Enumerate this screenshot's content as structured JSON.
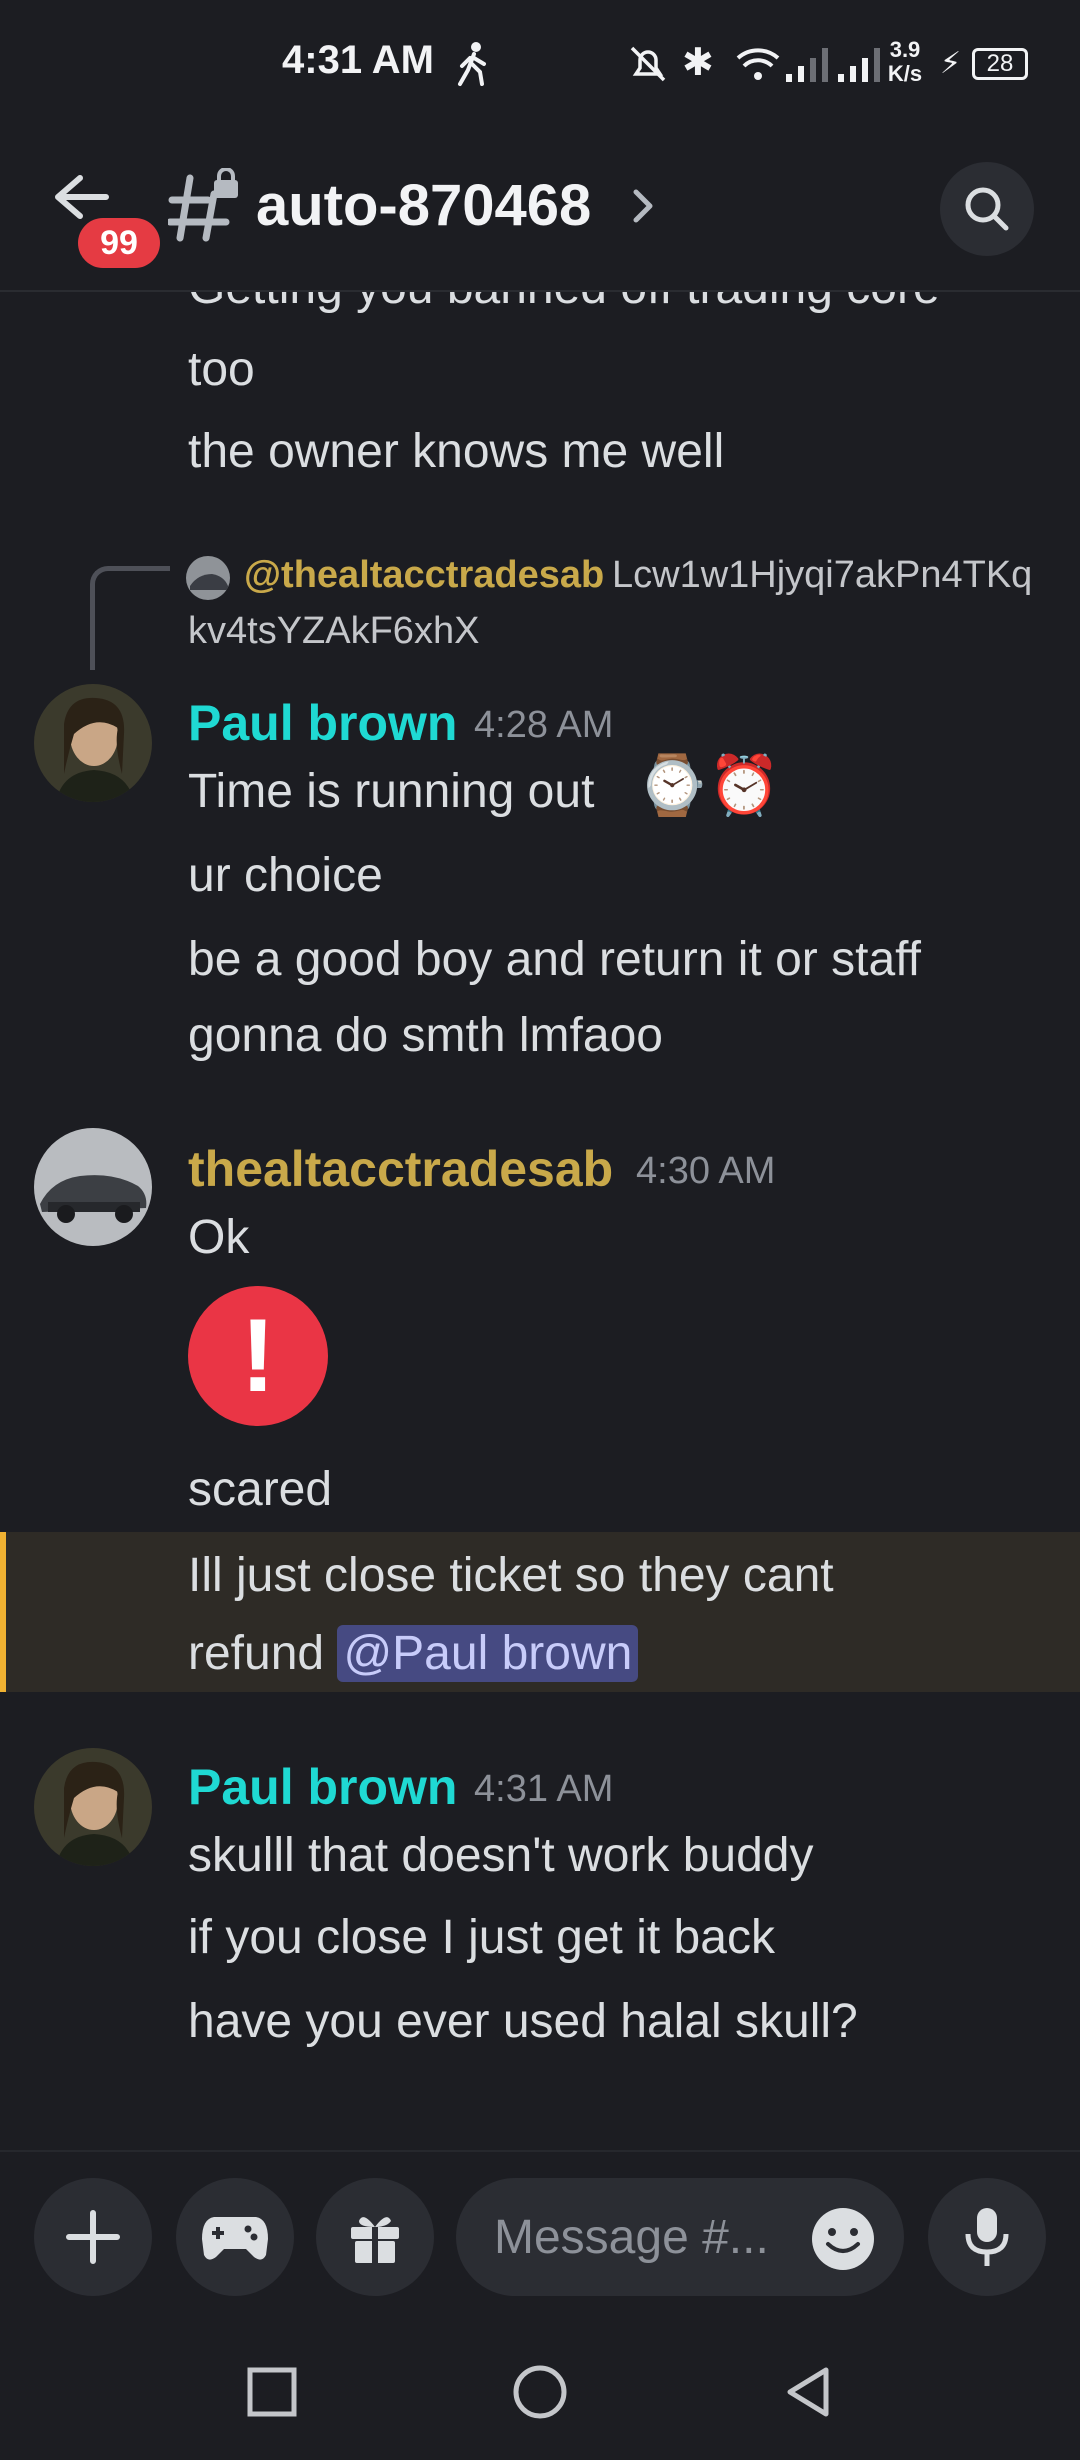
{
  "status_bar": {
    "time": "4:31 AM",
    "net_speed_top": "3.9",
    "net_speed_bottom": "K/s",
    "battery": "28"
  },
  "header": {
    "badge": "99",
    "channel": "auto-870468"
  },
  "messages": {
    "cut_line_1": "Getting you banned off trading core",
    "cut_line_2": "too",
    "cut_line_3": "the owner knows me well",
    "reply_user": "@thealtacctradesab",
    "reply_text_1": "Lcw1w1Hjyqi7akPn4TKq",
    "reply_text_2": "kv4tsYZAkF6xhX",
    "m1": {
      "user": "Paul brown",
      "time": "4:28 AM",
      "line1": "Time is running out",
      "line1_emoji": "⌚⏰",
      "line2": "ur choice",
      "line3": "be a good boy and return it or staff",
      "line4": "gonna do smth lmfaoo"
    },
    "m2": {
      "user": "thealtacctradesab",
      "time": "4:30 AM",
      "line1": "Ok",
      "line2": "scared",
      "line3": "Ill just close ticket so they cant",
      "line4_pre": "refund ",
      "mention": "@Paul brown"
    },
    "m3": {
      "user": "Paul brown",
      "time": "4:31 AM",
      "line1": "skulll that doesn't work buddy",
      "line2": "if you close I just get it back",
      "line3": "have you ever used halal skull?"
    }
  },
  "composer": {
    "placeholder": "Message #..."
  },
  "colors": {
    "paul": "#1fd9d3",
    "thealt": "#c9a94a",
    "mention_bg": "#464a82",
    "highlight_bar": "#f0b232",
    "badge": "#e53b43"
  }
}
